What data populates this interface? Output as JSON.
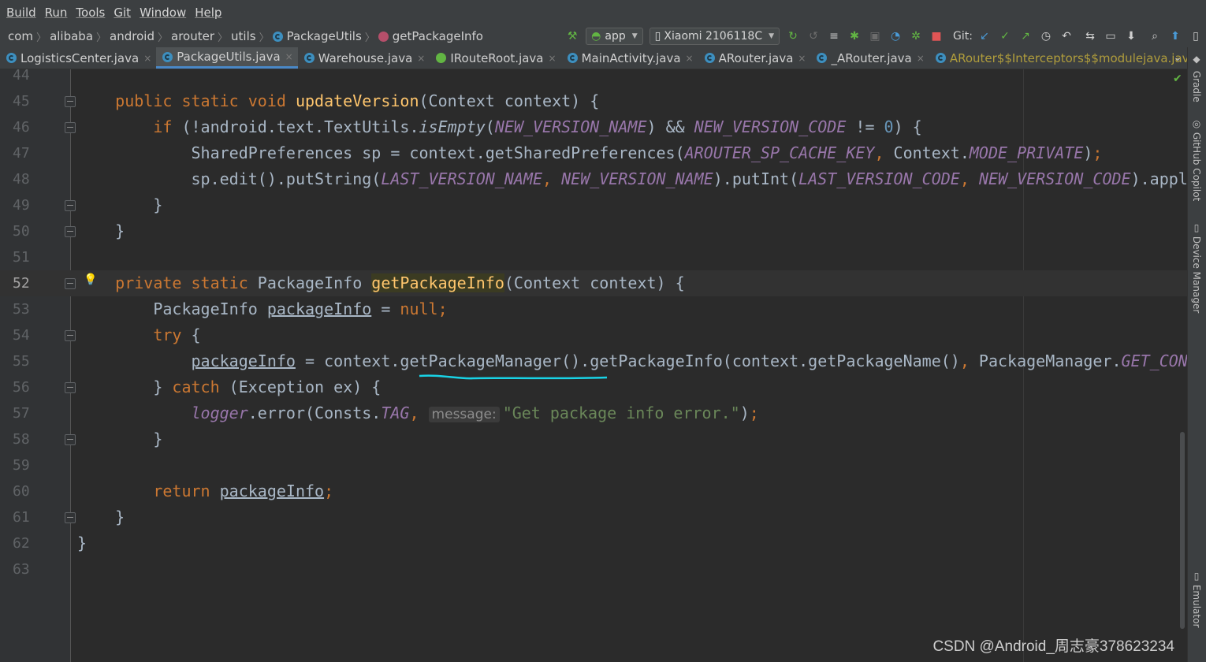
{
  "menu": [
    "Build",
    "Run",
    "Tools",
    "Git",
    "Window",
    "Help"
  ],
  "breadcrumbs": [
    {
      "label": "com",
      "icon": null
    },
    {
      "label": "alibaba",
      "icon": null
    },
    {
      "label": "android",
      "icon": null
    },
    {
      "label": "arouter",
      "icon": null
    },
    {
      "label": "utils",
      "icon": null
    },
    {
      "label": "PackageUtils",
      "icon": "class-icon"
    },
    {
      "label": "getPackageInfo",
      "icon": "method-icon"
    }
  ],
  "toolbar": {
    "run_config": "app",
    "device": "Xiaomi 2106118C",
    "git_label": "Git:"
  },
  "tabs": [
    {
      "label": "LogisticsCenter.java",
      "icon": "class-icon",
      "active": false
    },
    {
      "label": "PackageUtils.java",
      "icon": "class-icon",
      "active": true
    },
    {
      "label": "Warehouse.java",
      "icon": "class-icon",
      "active": false
    },
    {
      "label": "IRouteRoot.java",
      "icon": "interface-icon",
      "active": false
    },
    {
      "label": "MainActivity.java",
      "icon": "class-icon",
      "active": false
    },
    {
      "label": "ARouter.java",
      "icon": "class-icon",
      "active": false
    },
    {
      "label": "_ARouter.java",
      "icon": "class-icon",
      "active": false
    },
    {
      "label": "ARouter$$Interceptors$$modulejava.java",
      "icon": "class-icon",
      "active": false
    }
  ],
  "right_tools": [
    "Gradle",
    "GitHub Copilot",
    "Device Manager",
    "Emulator"
  ],
  "editor": {
    "current_line": 52,
    "lines": [
      {
        "n": "44"
      },
      {
        "n": "45"
      },
      {
        "n": "46"
      },
      {
        "n": "47"
      },
      {
        "n": "48"
      },
      {
        "n": "49"
      },
      {
        "n": "50"
      },
      {
        "n": "51"
      },
      {
        "n": "52"
      },
      {
        "n": "53"
      },
      {
        "n": "54"
      },
      {
        "n": "55"
      },
      {
        "n": "56"
      },
      {
        "n": "57"
      },
      {
        "n": "58"
      },
      {
        "n": "59"
      },
      {
        "n": "60"
      },
      {
        "n": "61"
      },
      {
        "n": "62"
      },
      {
        "n": "63"
      }
    ],
    "inlay_hint": "message:"
  },
  "watermark": "CSDN @Android_周志豪378623234",
  "colors": {
    "keyword": "#cc7832",
    "function": "#ffc66d",
    "static_field": "#9876aa",
    "string": "#6a8759",
    "number": "#6897bb",
    "default": "#a9b7c6"
  }
}
